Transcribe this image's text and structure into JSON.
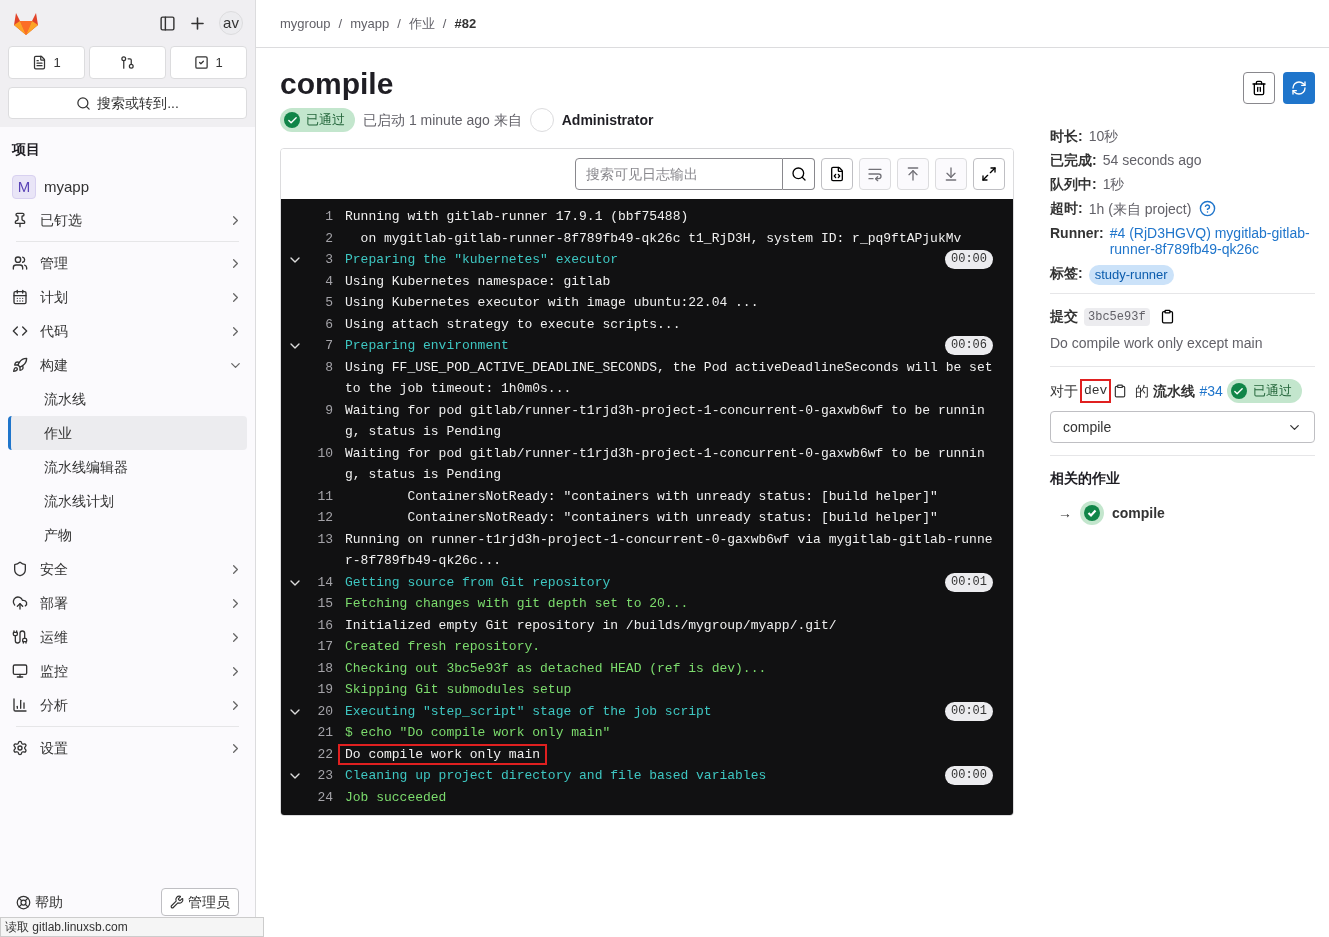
{
  "sidebar": {
    "avatar": "av",
    "counters": [
      {
        "kind": "issues",
        "count": "1"
      },
      {
        "kind": "merge_requests"
      },
      {
        "kind": "todos",
        "count": "1"
      }
    ],
    "search": "搜索或转到...",
    "section_title": "项目",
    "project": {
      "initial": "M",
      "name": "myapp"
    },
    "items": [
      {
        "label": "已钉选",
        "expanded": false,
        "divider_after": true
      },
      {
        "label": "管理",
        "expanded": false
      },
      {
        "label": "计划",
        "expanded": false
      },
      {
        "label": "代码",
        "expanded": false
      },
      {
        "label": "构建",
        "expanded": true,
        "children": [
          {
            "label": "流水线",
            "selected": false
          },
          {
            "label": "作业",
            "selected": true
          },
          {
            "label": "流水线编辑器",
            "selected": false
          },
          {
            "label": "流水线计划",
            "selected": false
          },
          {
            "label": "产物",
            "selected": false
          }
        ]
      },
      {
        "label": "安全",
        "expanded": false
      },
      {
        "label": "部署",
        "expanded": false
      },
      {
        "label": "运维",
        "expanded": false
      },
      {
        "label": "监控",
        "expanded": false
      },
      {
        "label": "分析",
        "expanded": false,
        "divider_after": true
      },
      {
        "label": "设置",
        "expanded": false
      }
    ],
    "help": "帮助",
    "admin": "管理员"
  },
  "breadcrumb": [
    {
      "label": "mygroup",
      "current": false
    },
    {
      "separator": "/",
      "label": "myapp",
      "current": false
    },
    {
      "separator": "/",
      "label": "作业",
      "current": false
    },
    {
      "separator": "/",
      "label": "#82",
      "current": true
    }
  ],
  "job": {
    "title": "compile",
    "status": "已通过",
    "started": "已启动 1 minute ago 来自",
    "user": "Administrator"
  },
  "log": {
    "search_placeholder": "搜索可见日志输出",
    "lines": [
      {
        "n": "1",
        "text": "Running with gitlab-runner 17.9.1 (bbf75488)",
        "kind": "plain"
      },
      {
        "n": "2",
        "text": "  on mygitlab-gitlab-runner-8f789fb49-qk26c t1_RjD3H, system ID: r_pq9ftAPjukMv",
        "kind": "plain"
      },
      {
        "n": "3",
        "text": "Preparing the \"kubernetes\" executor",
        "kind": "section",
        "duration": "00:00",
        "expanded": true
      },
      {
        "n": "4",
        "text": "Using Kubernetes namespace: gitlab",
        "kind": "plain"
      },
      {
        "n": "5",
        "text": "Using Kubernetes executor with image ubuntu:22.04 ...",
        "kind": "plain"
      },
      {
        "n": "6",
        "text": "Using attach strategy to execute scripts...",
        "kind": "plain"
      },
      {
        "n": "7",
        "text": "Preparing environment",
        "kind": "section",
        "duration": "00:06",
        "expanded": true
      },
      {
        "n": "8",
        "text": "Using FF_USE_POD_ACTIVE_DEADLINE_SECONDS, the Pod activeDeadlineSeconds will be set to the job timeout: 1h0m0s...",
        "kind": "plain"
      },
      {
        "n": "9",
        "text": "Waiting for pod gitlab/runner-t1rjd3h-project-1-concurrent-0-gaxwb6wf to be running, status is Pending",
        "kind": "plain"
      },
      {
        "n": "10",
        "text": "Waiting for pod gitlab/runner-t1rjd3h-project-1-concurrent-0-gaxwb6wf to be running, status is Pending",
        "kind": "plain"
      },
      {
        "n": "11",
        "text": "\tContainersNotReady: \"containers with unready status: [build helper]\"",
        "kind": "plain"
      },
      {
        "n": "12",
        "text": "\tContainersNotReady: \"containers with unready status: [build helper]\"",
        "kind": "plain"
      },
      {
        "n": "13",
        "text": "Running on runner-t1rjd3h-project-1-concurrent-0-gaxwb6wf via mygitlab-gitlab-runner-8f789fb49-qk26c...",
        "kind": "plain"
      },
      {
        "n": "14",
        "text": "Getting source from Git repository",
        "kind": "section",
        "duration": "00:01",
        "expanded": true
      },
      {
        "n": "15",
        "text": "Fetching changes with git depth set to 20...",
        "kind": "success"
      },
      {
        "n": "16",
        "text": "Initialized empty Git repository in /builds/mygroup/myapp/.git/",
        "kind": "plain"
      },
      {
        "n": "17",
        "text": "Created fresh repository.",
        "kind": "success"
      },
      {
        "n": "18",
        "text": "Checking out 3bc5e93f as detached HEAD (ref is dev)...",
        "kind": "success"
      },
      {
        "n": "19",
        "text": "Skipping Git submodules setup",
        "kind": "success"
      },
      {
        "n": "20",
        "text": "Executing \"step_script\" stage of the job script",
        "kind": "section",
        "duration": "00:01",
        "expanded": true
      },
      {
        "n": "21",
        "text": "$ echo \"Do compile work only main\"",
        "kind": "success"
      },
      {
        "n": "22",
        "text": "Do compile work only main",
        "kind": "plain",
        "highlighted": true
      },
      {
        "n": "23",
        "text": "Cleaning up project directory and file based variables",
        "kind": "section",
        "duration": "00:00",
        "expanded": true
      },
      {
        "n": "24",
        "text": "Job succeeded",
        "kind": "success"
      }
    ]
  },
  "details": [
    {
      "label": "时长:",
      "value": "10秒",
      "kind": "text"
    },
    {
      "label": "已完成:",
      "value": "54 seconds ago",
      "kind": "text"
    },
    {
      "label": "队列中:",
      "value": "1秒",
      "kind": "text"
    },
    {
      "label": "超时:",
      "value": "1h (来自 project)",
      "kind": "help"
    },
    {
      "label": "Runner:",
      "value": "#4 (RjD3HGVQ) mygitlab-gitlab-runner-8f789fb49-qk26c",
      "kind": "link"
    },
    {
      "label": "标签:",
      "value": "study-runner",
      "kind": "tag"
    }
  ],
  "commit": {
    "label": "提交",
    "sha": "3bc5e93f",
    "message": "Do compile work only except main"
  },
  "pipeline": {
    "prefix": "对于",
    "ref": "dev",
    "ref_highlighted": true,
    "of": "的",
    "label": "流水线",
    "number": "#34",
    "status": "已通过",
    "stage": "compile"
  },
  "related": {
    "title": "相关的作业",
    "jobs": [
      {
        "arrow": "→",
        "name": "compile"
      }
    ]
  },
  "status_bar": "读取 gitlab.linuxsb.com"
}
